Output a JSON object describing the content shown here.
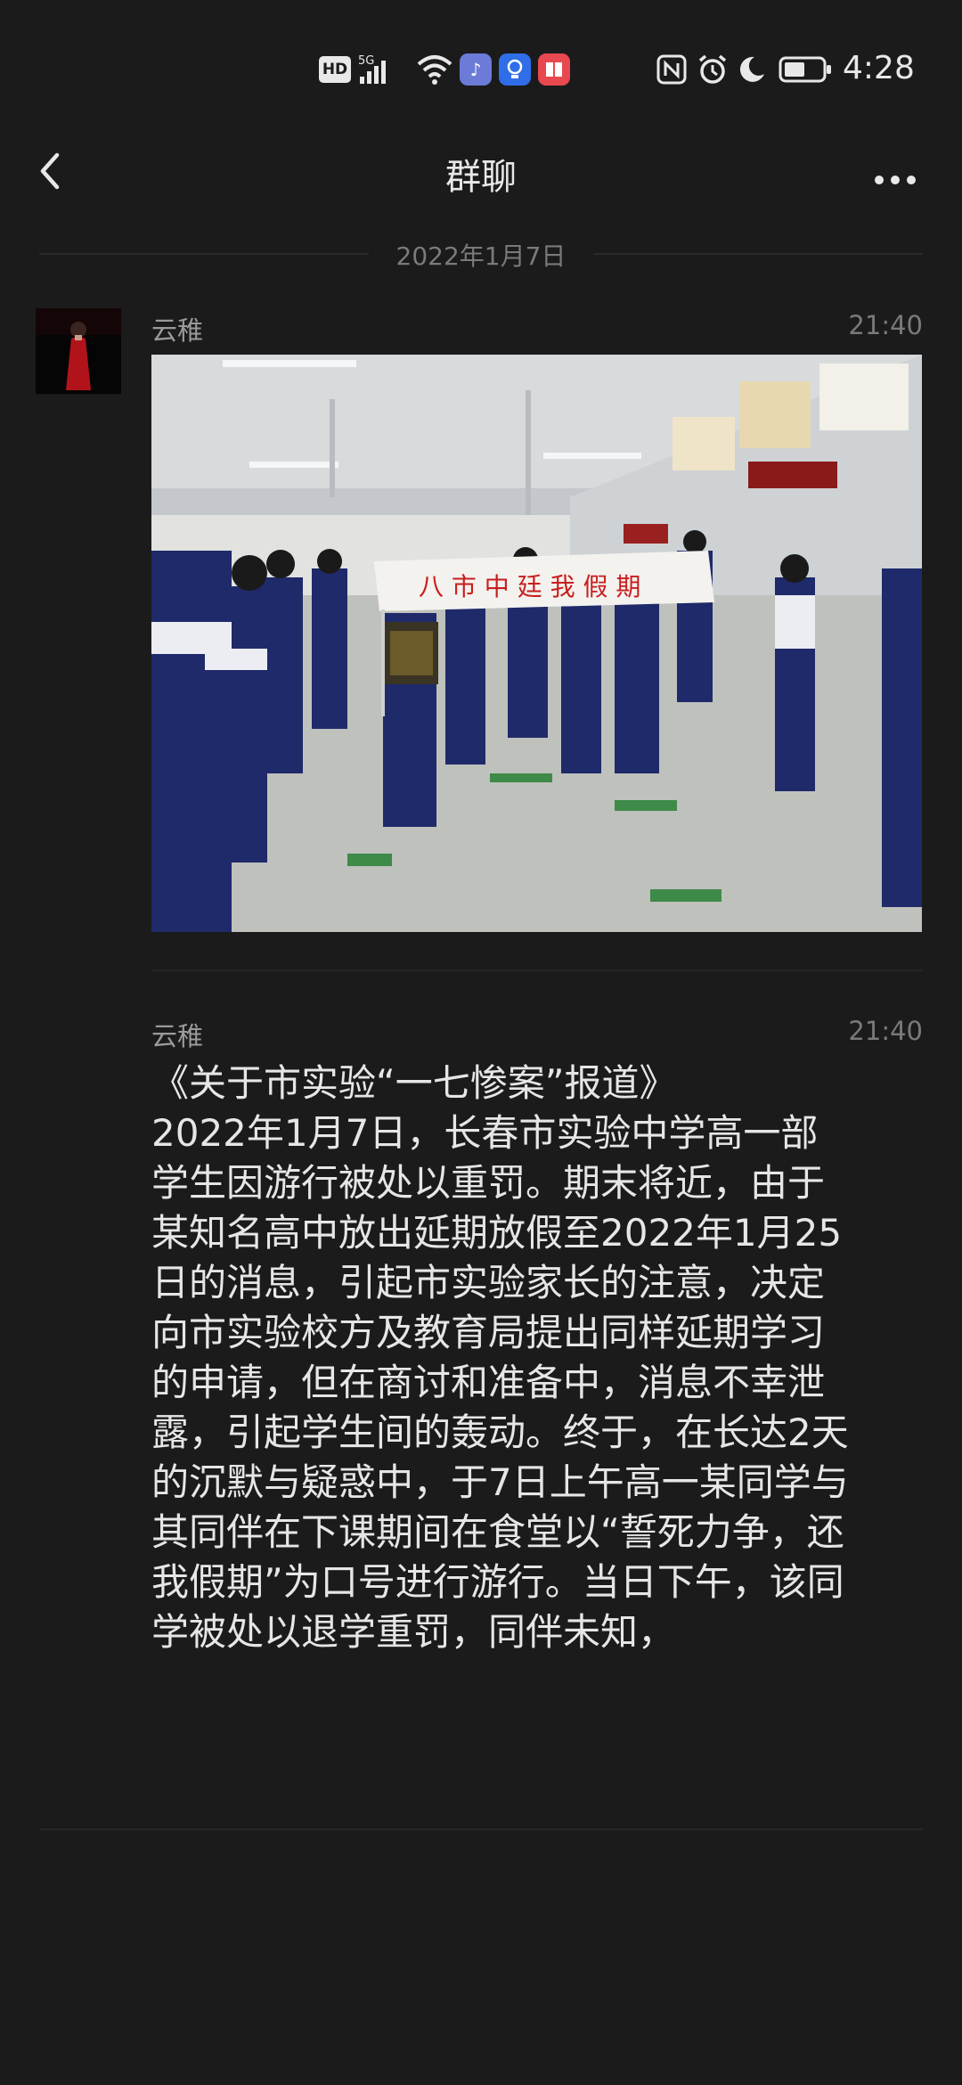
{
  "status_bar": {
    "hd_label": "HD",
    "network_label": "5G",
    "time": "4:28"
  },
  "nav": {
    "title": "群聊"
  },
  "date_separator": "2022年1月7日",
  "messages": [
    {
      "sender": "云稚",
      "time": "21:40",
      "type": "image",
      "banner_text": "八 市 中 廷 我 假 期"
    },
    {
      "sender": "云稚",
      "time": "21:40",
      "type": "text",
      "text": "《关于市实验“一七惨案”报道》\n2022年1月7日，长春市实验中学高一部\n学生因游行被处以重罚。期末将近，由于\n某知名高中放出延期放假至2022年1月25\n日的消息，引起市实验家长的注意，决定\n向市实验校方及教育局提出同样延期学习\n的申请，但在商讨和准备中，消息不幸泄\n露，引起学生间的轰动。终于，在长达2天\n的沉默与疑惑中，于7日上午高一某同学与\n其同伴在下课期间在食堂以“誓死力争，还\n我假期”为口号进行游行。当日下午，该同\n学被处以退学重罚，同伴未知，"
    }
  ],
  "colors": {
    "background": "#1b1b1b",
    "text_primary": "#e6e6e6",
    "text_secondary": "#9a9a9a",
    "text_muted": "#7a7a7a"
  }
}
